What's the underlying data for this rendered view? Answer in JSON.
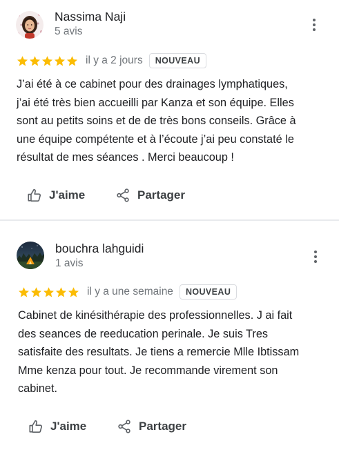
{
  "reviews": [
    {
      "author": "Nassima Naji",
      "review_count": "5 avis",
      "rating": 5,
      "time_ago": "il y a 2 jours",
      "badge": "NOUVEAU",
      "text_lines": [
        "J’ai été à ce cabinet pour des drainages lymphatiques,",
        "j’ai été très bien accueilli par Kanza et son équipe. Elles",
        "sont au petits soins et de de très bons conseils. Grâce à",
        "une équipe compétente et à l’écoute j’ai peu constaté le",
        "résultat de mes séances . Merci beaucoup !"
      ],
      "like_label": "J'aime",
      "share_label": "Partager"
    },
    {
      "author": "bouchra lahguidi",
      "review_count": "1 avis",
      "rating": 5,
      "time_ago": "il y a une semaine",
      "badge": "NOUVEAU",
      "text_lines": [
        "Cabinet de kinésithérapie des professionnelles. J ai fait",
        "des seances de reeducation perinale. Je suis Tres",
        "satisfaite des resultats. Je tiens a remercie Mlle Ibtissam",
        "Mme kenza pour tout. Je recommande virement son",
        "cabinet."
      ],
      "like_label": "J'aime",
      "share_label": "Partager"
    }
  ],
  "colors": {
    "star": "#fbbc04",
    "text": "#202124",
    "secondary_text": "#70757a",
    "divider": "#e8eaed"
  },
  "icons": {
    "more": "more-vert-icon",
    "like": "thumb-up-icon",
    "share": "share-icon",
    "star": "star-icon"
  }
}
